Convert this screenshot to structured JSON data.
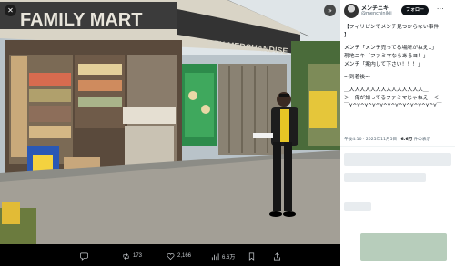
{
  "viewer": {
    "close_icon": "close-icon",
    "expand_icon": "expand-icon",
    "storefront": {
      "sign_main": "FAMILY  MART",
      "sign_secondary": "CEK   MERCHANDISE"
    },
    "actions": {
      "reply_count": "",
      "retweet_count": "173",
      "like_count": "2,166",
      "views_count": "6.6万"
    }
  },
  "tweet": {
    "user": {
      "name": "メンチニキ",
      "handle": "@menchinikii"
    },
    "follow_label": "フォロー",
    "more_icon": "···",
    "lines": [
      "【フィリピンでメンチ見つからない事件",
      "】",
      "",
      "メンチ「メンチ売ってる場所がねえ‥」",
      "現地ニキ「ファミマならあるヨ！」",
      "メンチ「案内して下さい！！！」",
      "",
      "〜到着後〜",
      "",
      "＿人人人人人人人人人人人人人人＿",
      "＞　俺が知ってるファミマじゃねえ　＜",
      "￣Y^Y^Y^Y^Y^Y^Y^Y^Y^Y^Y^Y￣"
    ],
    "meta": {
      "time_date": "午後4:10 · 2025年11月5日 · ",
      "views_value": "6.6万",
      "views_label": " 件の表示"
    }
  },
  "colors": {
    "viewer_bg": "#000000",
    "panel_bg": "#ffffff",
    "follow_bg": "#0f1419",
    "muted_text": "#536471",
    "sign_bg": "#3b3b3b"
  }
}
